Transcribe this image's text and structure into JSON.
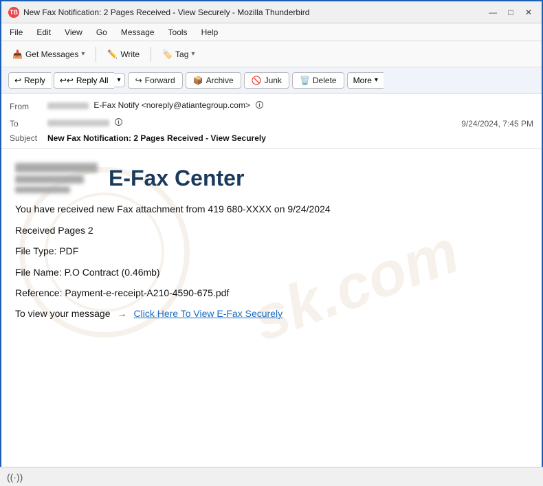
{
  "window": {
    "title": "New Fax Notification: 2 Pages Received - View Securely - Mozilla Thunderbird",
    "icon": "TB",
    "controls": {
      "minimize": "—",
      "maximize": "□",
      "close": "✕"
    }
  },
  "menubar": {
    "items": [
      "File",
      "Edit",
      "View",
      "Go",
      "Message",
      "Tools",
      "Help"
    ]
  },
  "toolbar": {
    "get_messages_label": "Get Messages",
    "write_label": "Write",
    "tag_label": "Tag"
  },
  "action_bar": {
    "reply_label": "Reply",
    "reply_all_label": "Reply All",
    "forward_label": "Forward",
    "archive_label": "Archive",
    "junk_label": "Junk",
    "delete_label": "Delete",
    "more_label": "More"
  },
  "email_header": {
    "from_label": "From",
    "from_value": "E-Fax Notify <noreply@atiantegroup.com>",
    "to_label": "To",
    "to_value": "",
    "date": "9/24/2024, 7:45 PM",
    "subject_label": "Subject",
    "subject_value": "New Fax Notification: 2 Pages Received - View Securely"
  },
  "email_body": {
    "company_name": "E-Fax Center",
    "fax_message": "You have received new Fax attachment from 419 680-XXXX on 9/24/2024",
    "pages_label": "Received Pages 2",
    "file_type": "File Type: PDF",
    "file_name": "File Name: P.O Contract (0.46mb)",
    "reference": "Reference: Payment-e-receipt-A210-4590-675.pdf",
    "view_text": "To view your message",
    "arrow": "→",
    "link_text": "Click Here To View E-Fax Securely"
  },
  "status_bar": {
    "wifi_icon": "((·))"
  }
}
